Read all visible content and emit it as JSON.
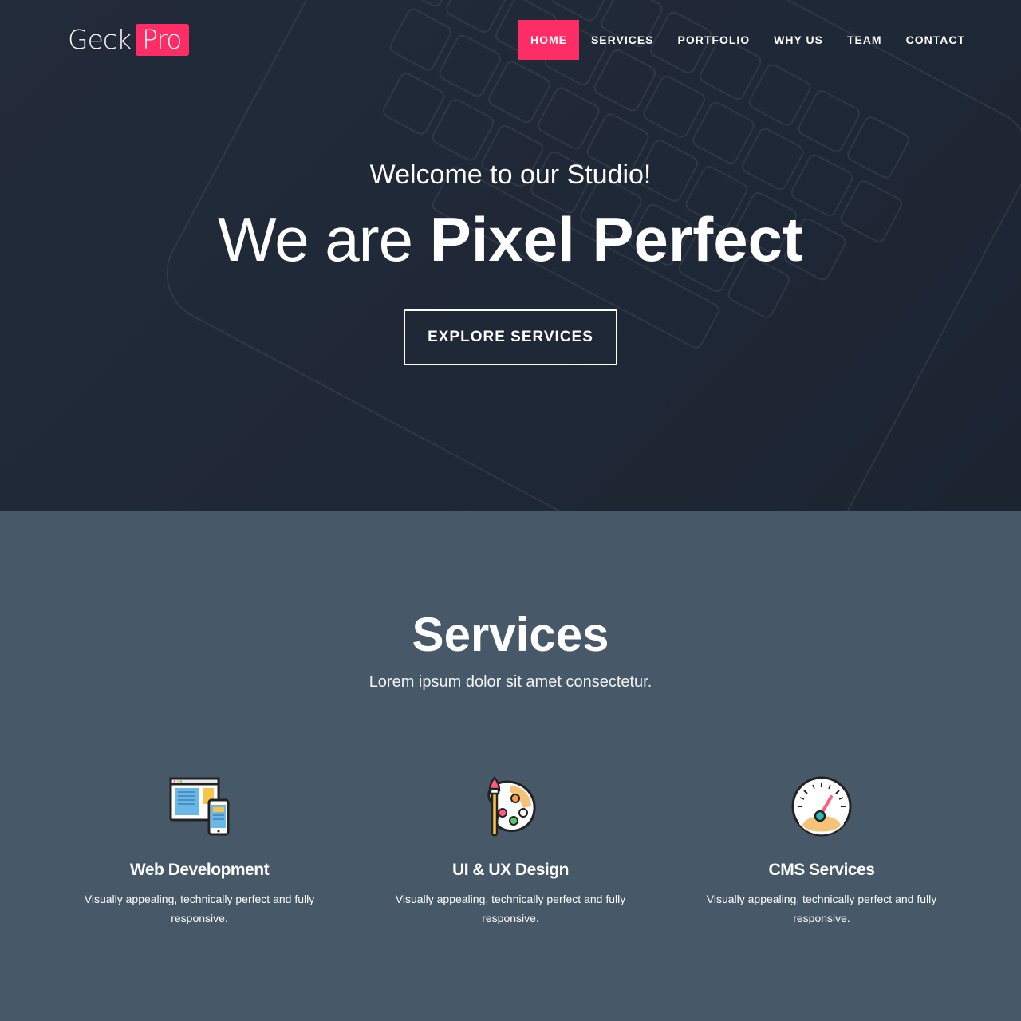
{
  "brand": {
    "name_part1": "Geck",
    "name_part2": "Pro",
    "accent": "#ff2d65"
  },
  "nav": {
    "items": [
      {
        "label": "HOME",
        "active": true
      },
      {
        "label": "SERVICES",
        "active": false
      },
      {
        "label": "PORTFOLIO",
        "active": false
      },
      {
        "label": "WHY US",
        "active": false
      },
      {
        "label": "TEAM",
        "active": false
      },
      {
        "label": "CONTACT",
        "active": false
      }
    ]
  },
  "hero": {
    "subtitle": "Welcome to our Studio!",
    "title_light": "We are",
    "title_bold": "Pixel Perfect",
    "cta_label": "EXPLORE SERVICES",
    "bg_color": "#1f2836"
  },
  "services": {
    "title": "Services",
    "subtitle": "Lorem ipsum dolor sit amet consectetur.",
    "bg_color": "#475868",
    "items": [
      {
        "icon": "web-development-icon",
        "title": "Web Development",
        "text": "Visually appealing, technically perfect and fully responsive."
      },
      {
        "icon": "palette-icon",
        "title": "UI & UX Design",
        "text": "Visually appealing, technically perfect and fully responsive."
      },
      {
        "icon": "speedometer-icon",
        "title": "CMS Services",
        "text": "Visually appealing, technically perfect and fully responsive."
      }
    ]
  }
}
